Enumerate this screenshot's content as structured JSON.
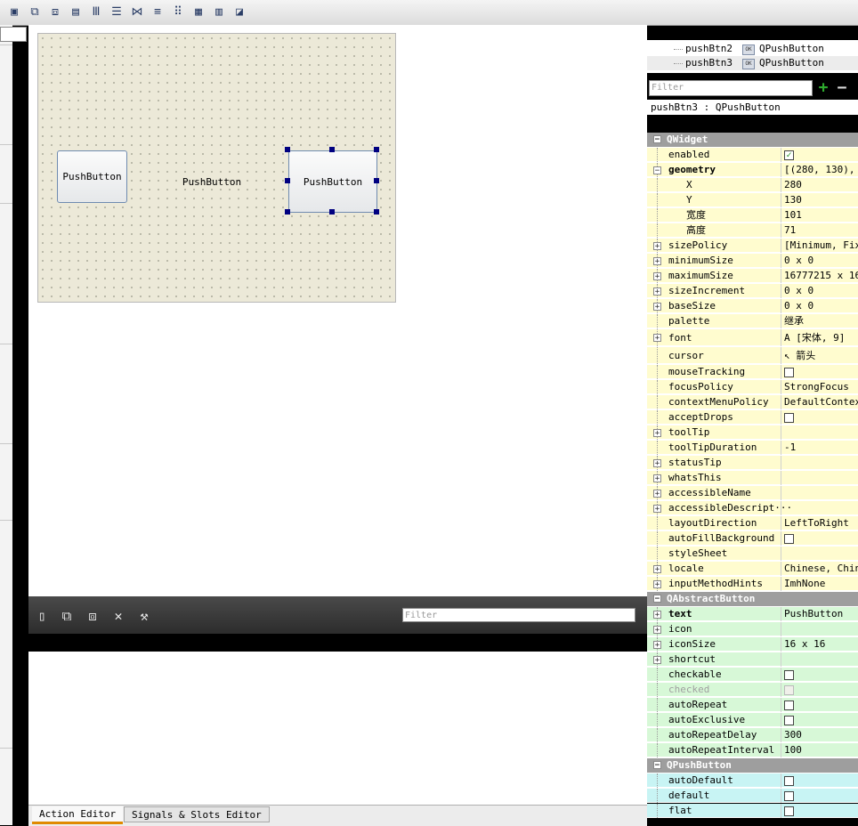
{
  "toolbar": {
    "icons": [
      "edit-widgets-icon",
      "edit-signals-slots-icon",
      "edit-buddies-icon",
      "edit-tab-order-icon",
      "layout-horizontal-icon",
      "layout-vertical-icon",
      "layout-horizontal-splitter-icon",
      "layout-vertical-splitter-icon",
      "layout-grid-icon",
      "layout-form-icon",
      "break-layout-icon",
      "adjust-size-icon"
    ]
  },
  "form": {
    "buttons": [
      "PushButton",
      "PushButton",
      "PushButton"
    ]
  },
  "action_editor": {
    "filter_placeholder": "Filter",
    "tabs": [
      "Action Editor",
      "Signals & Slots Editor"
    ]
  },
  "object_inspector": {
    "rows": [
      {
        "name": "pushBtn2",
        "class": "QPushButton"
      },
      {
        "name": "pushBtn3",
        "class": "QPushButton"
      }
    ]
  },
  "property_editor": {
    "filter_placeholder": "Filter",
    "object_label": "pushBtn3 : QPushButton",
    "sections": [
      {
        "title": "QWidget",
        "color": "#fffccf",
        "props": [
          {
            "name": "enabled",
            "value": "",
            "check": true,
            "checked": true
          },
          {
            "name": "geometry",
            "value": "[(280, 130), ·",
            "bold": true,
            "expanded": true
          },
          {
            "name": "X",
            "value": "280",
            "sub": true
          },
          {
            "name": "Y",
            "value": "130",
            "sub": true
          },
          {
            "name": "宽度",
            "value": "101",
            "sub": true
          },
          {
            "name": "高度",
            "value": "71",
            "sub": true
          },
          {
            "name": "sizePolicy",
            "value": "[Minimum, Fix·",
            "expand": true
          },
          {
            "name": "minimumSize",
            "value": "0 x 0",
            "expand": true
          },
          {
            "name": "maximumSize",
            "value": "16777215 x 16·",
            "expand": true
          },
          {
            "name": "sizeIncrement",
            "value": "0 x 0",
            "expand": true
          },
          {
            "name": "baseSize",
            "value": "0 x 0",
            "expand": true
          },
          {
            "name": "palette",
            "value": "继承"
          },
          {
            "name": "font",
            "value": "A  [宋体, 9]",
            "expand": true,
            "tall": true
          },
          {
            "name": "cursor",
            "value": "↖  箭头",
            "tall": true
          },
          {
            "name": "mouseTracking",
            "value": "",
            "check": true
          },
          {
            "name": "focusPolicy",
            "value": "StrongFocus"
          },
          {
            "name": "contextMenuPolicy",
            "value": "DefaultContex·"
          },
          {
            "name": "acceptDrops",
            "value": "",
            "check": true
          },
          {
            "name": "toolTip",
            "value": "",
            "expand": true
          },
          {
            "name": "toolTipDuration",
            "value": "-1"
          },
          {
            "name": "statusTip",
            "value": "",
            "expand": true
          },
          {
            "name": "whatsThis",
            "value": "",
            "expand": true
          },
          {
            "name": "accessibleName",
            "value": "",
            "expand": true
          },
          {
            "name": "accessibleDescript···",
            "value": "",
            "expand": true
          },
          {
            "name": "layoutDirection",
            "value": "LeftToRight"
          },
          {
            "name": "autoFillBackground",
            "value": "",
            "check": true
          },
          {
            "name": "styleSheet",
            "value": ""
          },
          {
            "name": "locale",
            "value": "Chinese, China",
            "expand": true
          },
          {
            "name": "inputMethodHints",
            "value": "ImhNone",
            "expand": true
          }
        ]
      },
      {
        "title": "QAbstractButton",
        "color": "#d7f8d7",
        "props": [
          {
            "name": "text",
            "value": "PushButton",
            "bold": true,
            "expand": true
          },
          {
            "name": "icon",
            "value": "",
            "expand": true
          },
          {
            "name": "iconSize",
            "value": "16 x 16",
            "expand": true
          },
          {
            "name": "shortcut",
            "value": "",
            "expand": true
          },
          {
            "name": "checkable",
            "value": "",
            "check": true
          },
          {
            "name": "checked",
            "value": "",
            "check": true,
            "disabled": true
          },
          {
            "name": "autoRepeat",
            "value": "",
            "check": true
          },
          {
            "name": "autoExclusive",
            "value": "",
            "check": true
          },
          {
            "name": "autoRepeatDelay",
            "value": "300"
          },
          {
            "name": "autoRepeatInterval",
            "value": "100"
          }
        ]
      },
      {
        "title": "QPushButton",
        "color": "#c8f4f4",
        "props": [
          {
            "name": "autoDefault",
            "value": "",
            "check": true
          },
          {
            "name": "default",
            "value": "",
            "check": true
          },
          {
            "name": "flat",
            "value": "",
            "check": true
          }
        ]
      }
    ]
  }
}
